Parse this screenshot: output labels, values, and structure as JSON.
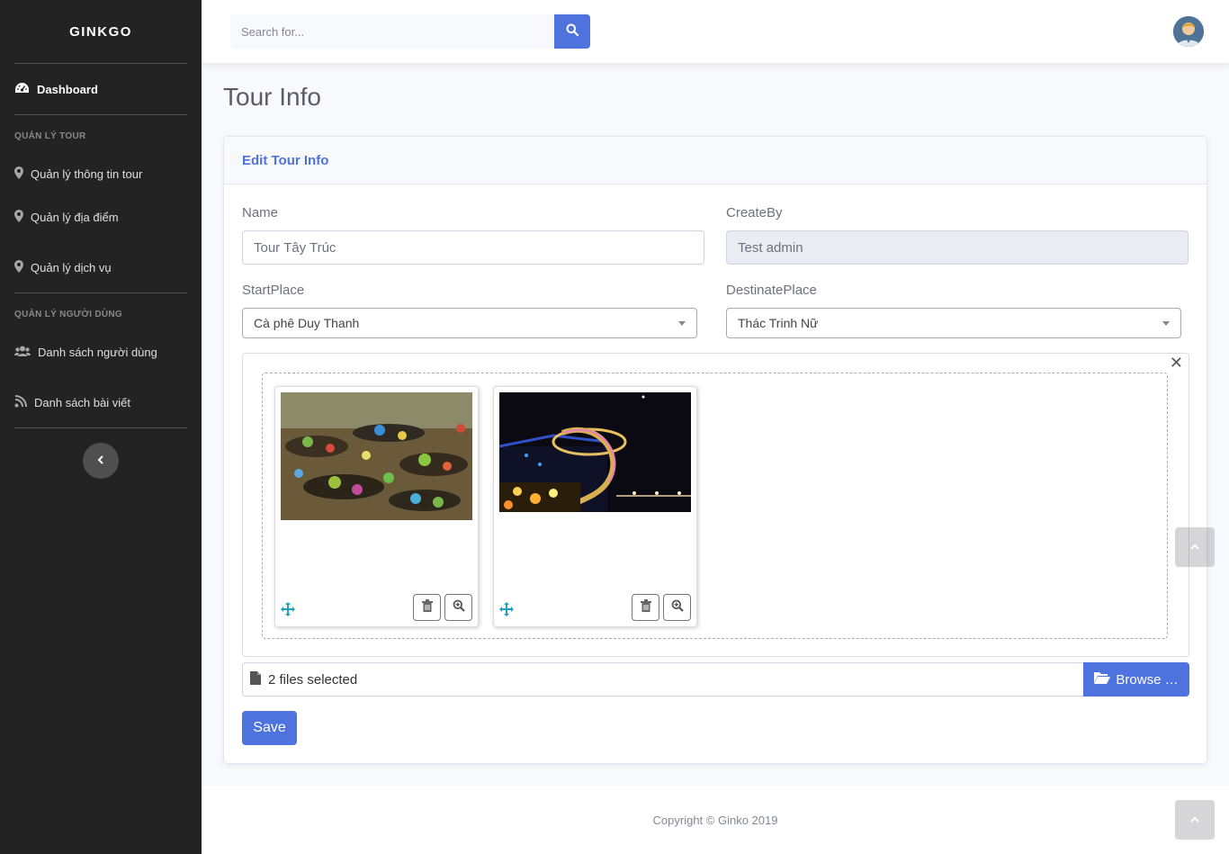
{
  "brand": "GINKGO",
  "sidebar": {
    "dashboard": "Dashboard",
    "section_tour": "QUẢN LÝ TOUR",
    "tour_items": [
      "Quản lý thông tin tour",
      "Quản lý địa điểm",
      "Quản lý dịch vụ"
    ],
    "section_users": "QUẢN LÝ NGƯỜI DÙNG",
    "user_items": [
      "Danh sách người dùng",
      "Danh sách bài viết"
    ]
  },
  "topbar": {
    "search_placeholder": "Search for..."
  },
  "page": {
    "title": "Tour Info",
    "card_title": "Edit Tour Info"
  },
  "form": {
    "name_label": "Name",
    "name_value": "Tour Tây Trúc",
    "createby_label": "CreateBy",
    "createby_value": "Test admin",
    "startplace_label": "StartPlace",
    "startplace_value": "Cà phê Duy Thanh",
    "destinate_label": "DestinatePlace",
    "destinate_value": "Thác Trinh Nữ",
    "files_caption": "2 files selected",
    "browse_label": "Browse …",
    "save_label": "Save"
  },
  "footer": {
    "copyright": "Copyright © Ginko 2019"
  },
  "colors": {
    "primary": "#4e73df",
    "sidebar": "#232323"
  }
}
